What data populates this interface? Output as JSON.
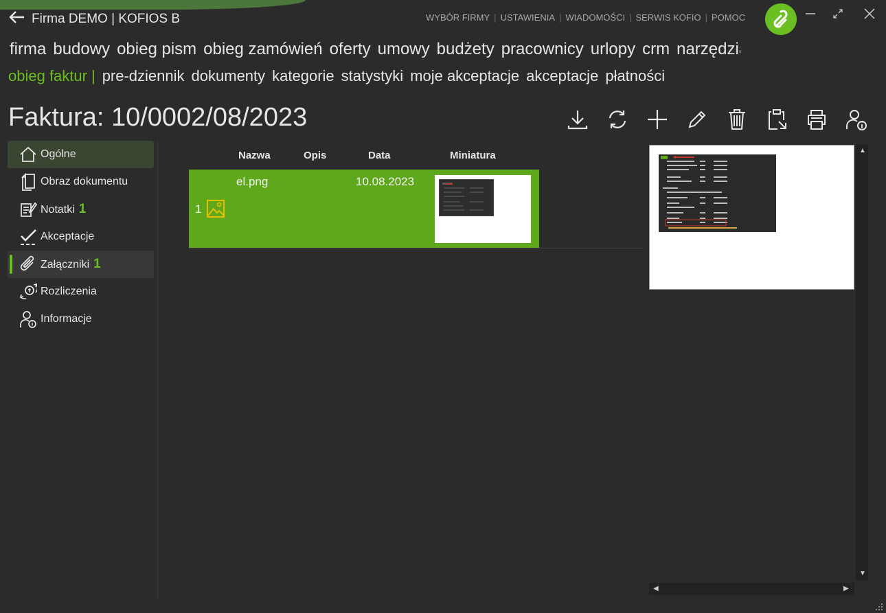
{
  "window": {
    "title": "Firma DEMO | KOFIOS B",
    "accent": "#6bbf22"
  },
  "topmenu": [
    "WYBÓR FIRMY",
    "USTAWIENIA",
    "WIADOMOŚCI",
    "SERWIS KOFIO",
    "POMOC"
  ],
  "modules": [
    "firma",
    "budowy",
    "obieg pism",
    "obieg zamówień",
    "oferty",
    "umowy",
    "budżety",
    "pracownicy",
    "urlopy",
    "crm",
    "narzędzia"
  ],
  "submodules": {
    "active": "obieg faktur",
    "items": [
      "pre-dziennik",
      "dokumenty",
      "kategorie",
      "statystyki",
      "moje akceptacje",
      "akceptacje",
      "płatności"
    ]
  },
  "page": {
    "title": "Faktura: 10/0002/08/2023"
  },
  "toolbar": [
    "download-icon",
    "refresh-icon",
    "add-icon",
    "edit-icon",
    "delete-icon",
    "clipboard-icon",
    "print-icon",
    "user-info-icon"
  ],
  "sidebar": {
    "items": [
      {
        "label": "Ogólne",
        "icon": "home-icon",
        "count": ""
      },
      {
        "label": "Obraz dokumentu",
        "icon": "document-icon",
        "count": ""
      },
      {
        "label": "Notatki",
        "icon": "notes-icon",
        "count": "1"
      },
      {
        "label": "Akceptacje",
        "icon": "checkmark-icon",
        "count": ""
      },
      {
        "label": "Załączniki",
        "icon": "paperclip-icon",
        "count": "1"
      },
      {
        "label": "Rozliczenia",
        "icon": "settlement-icon",
        "count": ""
      },
      {
        "label": "Informacje",
        "icon": "user-info-icon",
        "count": ""
      }
    ]
  },
  "grid": {
    "columns": [
      "Nazwa",
      "Opis",
      "Data",
      "Miniatura"
    ],
    "rows": [
      {
        "index": "1",
        "name": "el.png",
        "description": "",
        "date": "10.08.2023",
        "type_icon": "image-icon"
      }
    ],
    "row_color": "#5fa81b",
    "image_icon_color": "#f2c200"
  }
}
